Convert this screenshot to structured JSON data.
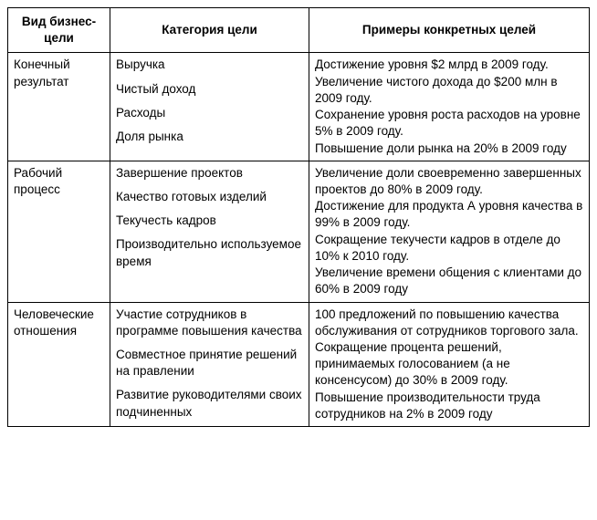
{
  "headers": {
    "col1": "Вид бизнес-цели",
    "col2": "Категория цели",
    "col3": "Примеры конкретных целей"
  },
  "rows": [
    {
      "type": "Конечный результат",
      "categories": [
        "Выручка",
        "Чистый доход",
        "Расходы",
        "Доля рынка"
      ],
      "examples": [
        "Достижение уровня $2 млрд в 2009 году.",
        "Увеличение чистого дохода до $200 млн в 2009 году.",
        "Сохранение уровня роста расходов на уровне 5% в 2009 году.",
        "Повышение доли рынка на 20% в 2009 году"
      ]
    },
    {
      "type": "Рабочий процесс",
      "categories": [
        "Завершение проектов",
        "Качество готовых изделий",
        "Текучесть кадров",
        "Производительно используемое время"
      ],
      "examples": [
        "Увеличение доли своевременно завершенных проектов до 80% в 2009 году.",
        "Достижение для продукта А уровня качества в 99% в 2009 году.",
        "Сокращение текучести кадров в отделе до 10% к 2010 году.",
        "Увеличение времени общения с клиентами до 60% в 2009 году"
      ]
    },
    {
      "type": "Человеческие отношения",
      "categories": [
        "Участие сотрудников в программе повышения качества",
        "Совместное принятие решений на правлении",
        "Развитие руководителями своих подчиненных"
      ],
      "examples": [
        "100 предложений по повышению качества обслуживания от сотрудников торгового зала.",
        "Сокращение процента решений, принимаемых голосованием (а не консенсусом) до 30% в 2009 году.",
        "Повышение производительности труда сотрудников на 2% в 2009 году"
      ]
    }
  ]
}
